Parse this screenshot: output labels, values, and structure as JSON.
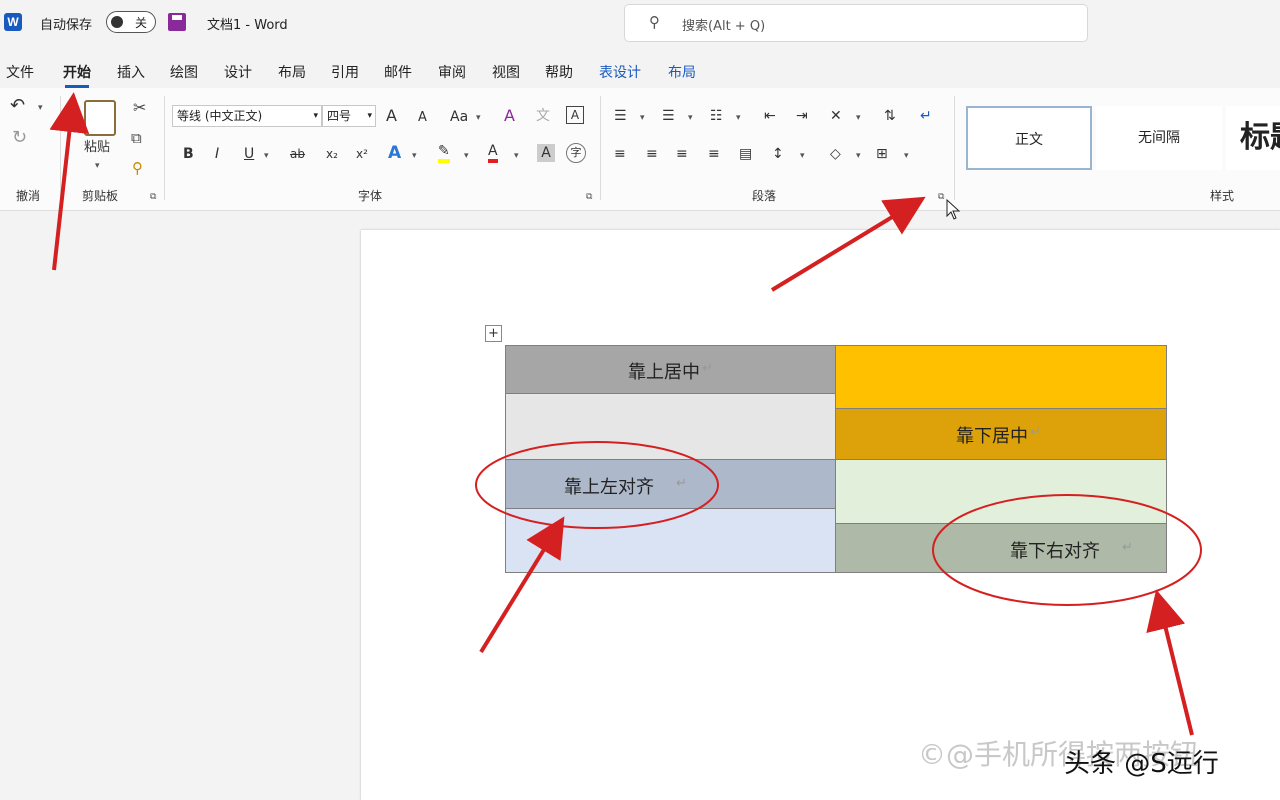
{
  "titlebar": {
    "app_logo": "W",
    "autosave_label": "自动保存",
    "autosave_state": "关",
    "doc_title": "文档1  -  Word",
    "search_placeholder": "搜索(Alt + Q)"
  },
  "tabs": [
    "文件",
    "开始",
    "插入",
    "绘图",
    "设计",
    "布局",
    "引用",
    "邮件",
    "审阅",
    "视图",
    "帮助",
    "表设计",
    "布局"
  ],
  "active_tab": "开始",
  "ribbon": {
    "undo_group": "撤消",
    "clipboard": {
      "paste": "粘贴",
      "label": "剪贴板"
    },
    "font": {
      "name": "等线 (中文正文)",
      "size": "四号",
      "label": "字体",
      "grow": "A",
      "shrink": "A",
      "case": "Aa",
      "clear": "A",
      "pinyin": "文",
      "border": "A",
      "bold": "B",
      "italic": "I",
      "underline": "U",
      "strike": "ab",
      "sub": "x₂",
      "sup": "x²",
      "effects": "A",
      "highlight": "✎",
      "color": "A",
      "shading": "A",
      "circle": "字"
    },
    "paragraph": {
      "label": "段落"
    },
    "styles": {
      "normal": "正文",
      "no_spacing": "无间隔",
      "heading": "标题",
      "label": "样式"
    }
  },
  "table": {
    "cell_top_center": "靠上居中",
    "cell_bottom_center": "靠下居中",
    "cell_top_left": "靠上左对齐",
    "cell_bottom_right": "靠下右对齐",
    "para_mark": "↵",
    "move_handle": "+"
  },
  "colors": {
    "gray_dark": "#a6a6a6",
    "gray_light": "#e7e6e6",
    "orange": "#ffc000",
    "orange_dark": "#dda20a",
    "blue_gray": "#adb9ca",
    "blue_light": "#dae3f3",
    "green_light": "#e2efda",
    "green_gray": "#aeb9a7",
    "annotation_red": "#d42020"
  },
  "watermark": "©@手机所得按两按钮",
  "credit": "头条 @S远行"
}
